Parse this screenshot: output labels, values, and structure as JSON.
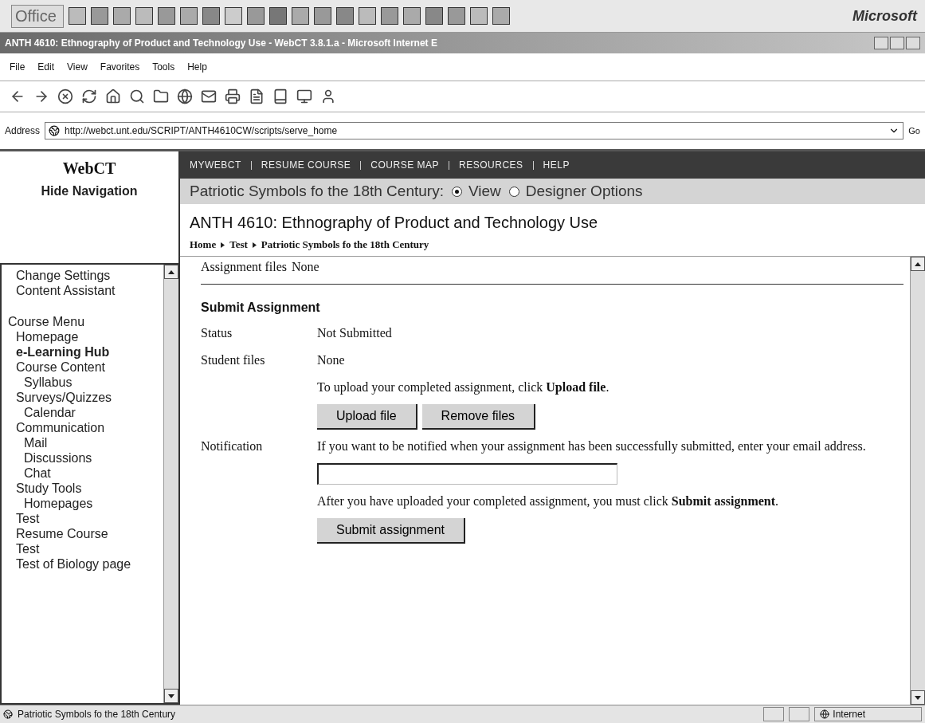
{
  "office_bar": {
    "label": "Office",
    "brand": "Microsoft"
  },
  "window": {
    "title": "ANTH 4610: Ethnography of Product and Technology Use - WebCT 3.8.1.a - Microsoft Internet E"
  },
  "menu": [
    "File",
    "Edit",
    "View",
    "Favorites",
    "Tools",
    "Help"
  ],
  "address_bar": {
    "label": "Address",
    "url": "http://webct.unt.edu/SCRIPT/ANTH4610CW/scripts/serve_home",
    "go": "Go"
  },
  "sidebar": {
    "logo": "WebCT",
    "hide_link": "Hide Navigation",
    "settings_items": [
      "Change Settings",
      "Content Assistant"
    ],
    "course_menu": {
      "title": "Course Menu",
      "items": [
        {
          "label": "Homepage",
          "selected": false
        },
        {
          "label": "e-Learning Hub",
          "selected": true
        },
        {
          "label": "Course Content",
          "selected": false,
          "children": [
            {
              "label": "Syllabus",
              "selected": false
            }
          ]
        },
        {
          "label": "Surveys/Quizzes",
          "selected": false,
          "children": [
            {
              "label": "Calendar",
              "selected": false
            }
          ]
        },
        {
          "label": "Communication",
          "selected": false,
          "children": [
            {
              "label": "Mail",
              "selected": false
            },
            {
              "label": "Discussions",
              "selected": false
            },
            {
              "label": "Chat",
              "selected": false
            }
          ]
        },
        {
          "label": "Study Tools",
          "selected": false,
          "children": [
            {
              "label": "Homepages",
              "selected": false
            }
          ]
        },
        {
          "label": "Test",
          "selected": false
        },
        {
          "label": "Resume Course",
          "selected": false
        },
        {
          "label": "Test",
          "selected": false
        },
        {
          "label": "Test of Biology page",
          "selected": false
        }
      ]
    }
  },
  "top_nav": [
    "MYWEBCT",
    "RESUME COURSE",
    "COURSE MAP",
    "RESOURCES",
    "HELP"
  ],
  "page_bar": {
    "title": "Patriotic Symbols fo the 18th Century:",
    "options": [
      {
        "label": "View",
        "selected": true
      },
      {
        "label": "Designer Options",
        "selected": false
      }
    ]
  },
  "course_title": "ANTH 4610: Ethnography of Product and Technology Use",
  "breadcrumb": [
    "Home",
    "Test",
    "Patriotic Symbols fo the 18th Century"
  ],
  "assignment_files": {
    "label": "Assignment files",
    "value": "None"
  },
  "submit_section": {
    "heading": "Submit Assignment",
    "status": {
      "label": "Status",
      "value": "Not Submitted"
    },
    "student_files": {
      "label": "Student files",
      "value": "None",
      "hint": "To upload your completed assignment, click **Upload file**.",
      "buttons": [
        "Upload file",
        "Remove files"
      ]
    },
    "notification": {
      "label": "Notification",
      "hint": "If you want to be notified when your assignment has been successfully submitted, enter your email address."
    },
    "final_hint": "After you have uploaded your completed assignment, you must click **Submit assignment**.",
    "submit_button": "Submit assignment"
  },
  "status_bar": {
    "text": "Patriotic Symbols fo the 18th Century",
    "zone": "Internet"
  }
}
